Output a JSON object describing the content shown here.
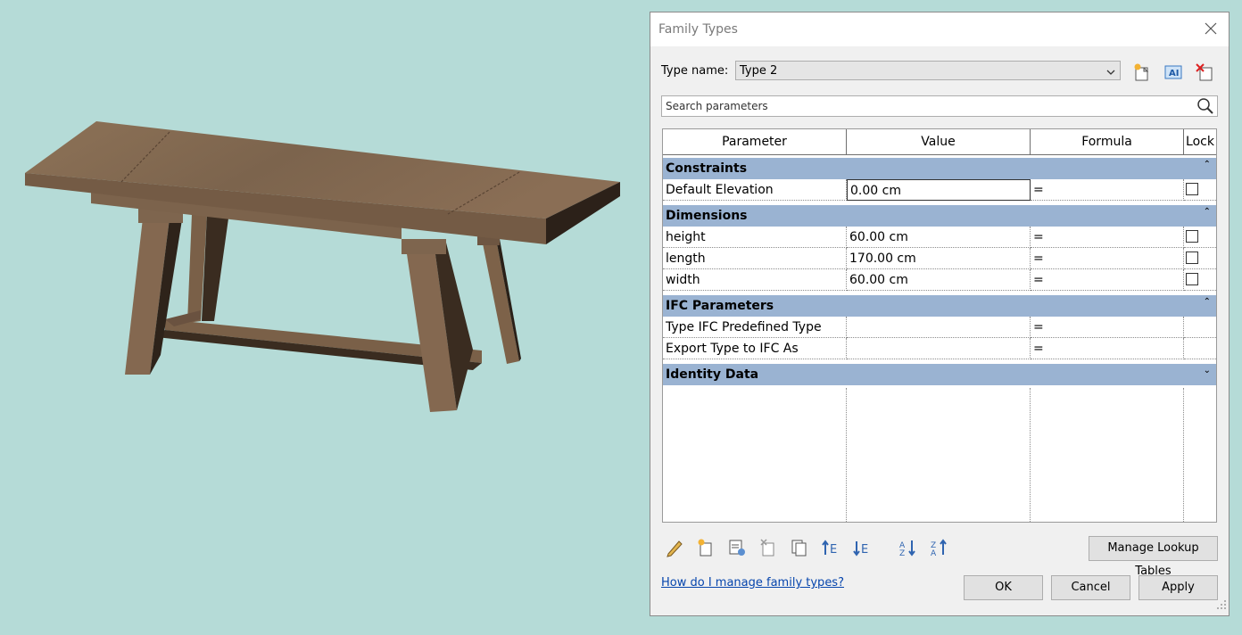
{
  "dialog": {
    "title": "Family Types",
    "type_name_label": "Type name:",
    "type_name_value": "Type 2",
    "search_placeholder": "Search parameters",
    "columns": [
      "Parameter",
      "Value",
      "Formula",
      "Lock"
    ],
    "groups": [
      {
        "name": "Constraints",
        "collapse_glyph": "⌃",
        "rows": [
          {
            "parameter": "Default Elevation",
            "value": "0.00 cm",
            "formula": "=",
            "lock": true
          }
        ]
      },
      {
        "name": "Dimensions",
        "collapse_glyph": "⌃",
        "rows": [
          {
            "parameter": "height",
            "value": "60.00 cm",
            "formula": "=",
            "lock": true
          },
          {
            "parameter": "length",
            "value": "170.00 cm",
            "formula": "=",
            "lock": true
          },
          {
            "parameter": "width",
            "value": "60.00 cm",
            "formula": "=",
            "lock": true
          }
        ]
      },
      {
        "name": "IFC Parameters",
        "collapse_glyph": "⌃",
        "rows": [
          {
            "parameter": "Type IFC Predefined Type",
            "value": "",
            "formula": "=",
            "lock": false
          },
          {
            "parameter": "Export Type to IFC As",
            "value": "",
            "formula": "=",
            "lock": false
          }
        ]
      },
      {
        "name": "Identity Data",
        "collapse_glyph": "⌄",
        "rows": []
      }
    ],
    "toolbar_icons": [
      "new-type-icon",
      "rename-type-icon",
      "delete-type-icon"
    ],
    "bottom_icons": [
      "edit-parameter-icon",
      "new-parameter-icon",
      "parameter-report-icon",
      "delete-parameter-icon",
      "copy-parameter-icon",
      "move-up-icon",
      "move-down-icon",
      "sort-ascending-icon",
      "sort-descending-icon"
    ],
    "manage_lookup_label": "Manage Lookup Tables",
    "help_link": "How do I manage family types?",
    "ok_label": "OK",
    "cancel_label": "Cancel",
    "apply_label": "Apply"
  },
  "colors": {
    "background": "#b5dbd7",
    "group_header": "#9ab3d2",
    "link": "#0645ad",
    "wood": "#8a6e55"
  }
}
